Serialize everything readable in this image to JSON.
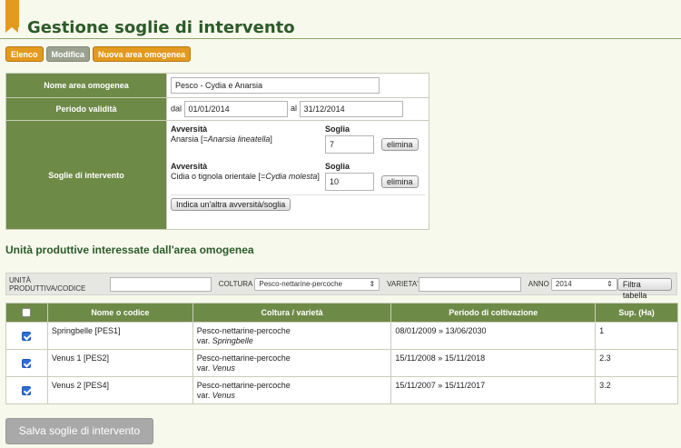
{
  "page": {
    "title": "Gestione soglie di intervento"
  },
  "tabs": [
    {
      "label": "Elenco"
    },
    {
      "label": "Modifica"
    },
    {
      "label": "Nuova area omogenea"
    }
  ],
  "form": {
    "name_label": "Nome area omogenea",
    "name_value": "Pesco - Cydia e Anarsia",
    "period_label": "Periodo validità",
    "from_label": "dal",
    "from_value": "01/01/2014",
    "to_label": "al",
    "to_value": "31/12/2014",
    "thresholds_label": "Soglie di intervento",
    "adversity_header": "Avversità",
    "threshold_header": "Soglia",
    "remove_label": "elimina",
    "adversities": [
      {
        "name": "Anarsia [=",
        "latin": "Anarsia lineatella",
        "close": "]",
        "threshold": "7"
      },
      {
        "name": "Cidia o tignola orientale [=",
        "latin": "Cydia molesta",
        "close": "]",
        "threshold": "10"
      }
    ],
    "add_button": "Indica un'altra avversità/soglia"
  },
  "units_section": {
    "heading": "Unità produttive interessate dall'area omogenea"
  },
  "filter": {
    "unit_label": "UNITÀ PRODUTTIVA/CODICE",
    "unit_value": "",
    "crop_label": "COLTURA",
    "crop_value": "Pesco-nettarine-percoche",
    "variety_label": "VARIETA'",
    "variety_value": "",
    "year_label": "ANNO",
    "year_value": "2014",
    "filter_button": "Filtra tabella"
  },
  "table": {
    "columns": [
      "Nome o codice",
      "Coltura / varietà",
      "Periodo di coltivazione",
      "Sup. (Ha)"
    ],
    "rows": [
      {
        "name": "Springbelle [PES1]",
        "crop": "Pesco-nettarine-percoche",
        "var_prefix": "var.",
        "variety": "Springbelle",
        "period": "08/01/2009 » 13/06/2030",
        "area": "1",
        "checked": true
      },
      {
        "name": "Venus 1 [PES2]",
        "crop": "Pesco-nettarine-percoche",
        "var_prefix": "var.",
        "variety": "Venus",
        "period": "15/11/2008 » 15/11/2018",
        "area": "2.3",
        "checked": true
      },
      {
        "name": "Venus 2 [PES4]",
        "crop": "Pesco-nettarine-percoche",
        "var_prefix": "var.",
        "variety": "Venus",
        "period": "15/11/2007 » 15/11/2017",
        "area": "3.2",
        "checked": true
      }
    ]
  },
  "save_button": "Salva soglie di intervento"
}
